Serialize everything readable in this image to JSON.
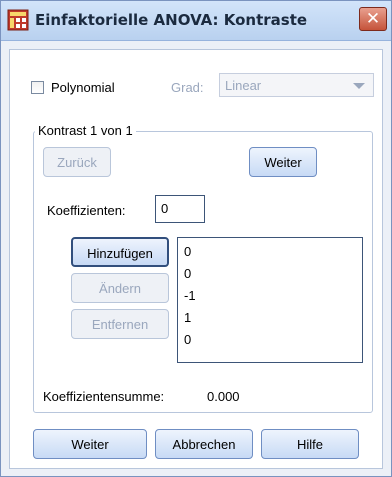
{
  "window": {
    "title": "Einfaktorielle ANOVA: Kontraste",
    "close_glyph": "✕"
  },
  "polynomial": {
    "label": "Polynomial",
    "checked": false,
    "degree_label": "Grad:",
    "degree_value": "Linear"
  },
  "group": {
    "title": "Kontrast 1 von 1",
    "back_label": "Zurück",
    "next_label": "Weiter",
    "coefficients_label": "Koeffizienten:",
    "coefficients_value": "0",
    "add_label": "Hinzufügen",
    "change_label": "Ändern",
    "remove_label": "Entfernen",
    "coefficient_list": [
      "0",
      "0",
      "-1",
      "1",
      "0"
    ],
    "sum_label": "Koeffizientensumme:",
    "sum_value": "0.000"
  },
  "footer": {
    "continue_label": "Weiter",
    "cancel_label": "Abbrechen",
    "help_label": "Hilfe"
  },
  "icons": {
    "title": "table-grid-icon",
    "close": "close-icon",
    "dropdown": "chevron-down-icon"
  },
  "colors": {
    "titlebar": "#c7dcf6",
    "close": "#c5533a",
    "button": "#c7daf5",
    "disabled_text": "#9aa7bd"
  }
}
